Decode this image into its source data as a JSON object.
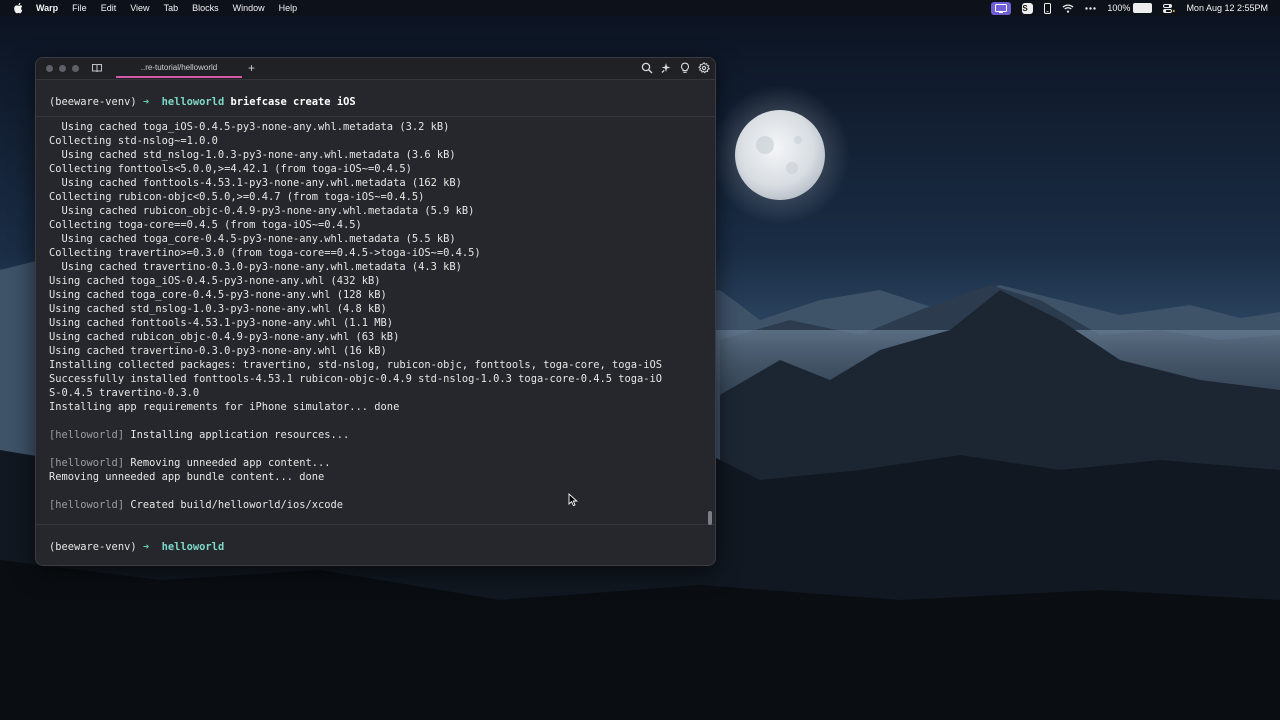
{
  "menubar": {
    "app_name": "Warp",
    "menus": [
      "File",
      "Edit",
      "View",
      "Tab",
      "Blocks",
      "Window",
      "Help"
    ],
    "battery_percent": "100%",
    "datetime": "Mon Aug 12  2:55PM",
    "s_badge": "S"
  },
  "window": {
    "tab_title": "..re-tutorial/helloworld",
    "new_tab_symbol": "+"
  },
  "terminal": {
    "first_prompt": {
      "venv": "(beeware-venv)",
      "arrow": "➜",
      "cwd": "helloworld",
      "command": "briefcase create iOS"
    },
    "output": [
      {
        "text": "  Using cached toga_iOS-0.4.5-py3-none-any.whl.metadata (3.2 kB)"
      },
      {
        "text": "Collecting std-nslog~=1.0.0"
      },
      {
        "text": "  Using cached std_nslog-1.0.3-py3-none-any.whl.metadata (3.6 kB)"
      },
      {
        "text": "Collecting fonttools<5.0.0,>=4.42.1 (from toga-iOS~=0.4.5)"
      },
      {
        "text": "  Using cached fonttools-4.53.1-py3-none-any.whl.metadata (162 kB)"
      },
      {
        "text": "Collecting rubicon-objc<0.5.0,>=0.4.7 (from toga-iOS~=0.4.5)"
      },
      {
        "text": "  Using cached rubicon_objc-0.4.9-py3-none-any.whl.metadata (5.9 kB)"
      },
      {
        "text": "Collecting toga-core==0.4.5 (from toga-iOS~=0.4.5)"
      },
      {
        "text": "  Using cached toga_core-0.4.5-py3-none-any.whl.metadata (5.5 kB)"
      },
      {
        "text": "Collecting travertino>=0.3.0 (from toga-core==0.4.5->toga-iOS~=0.4.5)"
      },
      {
        "text": "  Using cached travertino-0.3.0-py3-none-any.whl.metadata (4.3 kB)"
      },
      {
        "text": "Using cached toga_iOS-0.4.5-py3-none-any.whl (432 kB)"
      },
      {
        "text": "Using cached toga_core-0.4.5-py3-none-any.whl (128 kB)"
      },
      {
        "text": "Using cached std_nslog-1.0.3-py3-none-any.whl (4.8 kB)"
      },
      {
        "text": "Using cached fonttools-4.53.1-py3-none-any.whl (1.1 MB)"
      },
      {
        "text": "Using cached rubicon_objc-0.4.9-py3-none-any.whl (63 kB)"
      },
      {
        "text": "Using cached travertino-0.3.0-py3-none-any.whl (16 kB)"
      },
      {
        "text": "Installing collected packages: travertino, std-nslog, rubicon-objc, fonttools, toga-core, toga-iOS"
      },
      {
        "text": "Successfully installed fonttools-4.53.1 rubicon-objc-0.4.9 std-nslog-1.0.3 toga-core-0.4.5 toga-iO"
      },
      {
        "text": "S-0.4.5 travertino-0.3.0"
      },
      {
        "text": "Installing app requirements for iPhone simulator... done"
      },
      {
        "text": ""
      },
      {
        "tag": "[helloworld]",
        "text": " Installing application resources..."
      },
      {
        "text": ""
      },
      {
        "tag": "[helloworld]",
        "text": " Removing unneeded app content..."
      },
      {
        "text": "Removing unneeded app bundle content... done"
      },
      {
        "text": ""
      },
      {
        "tag": "[helloworld]",
        "text": " Created build/helloworld/ios/xcode"
      }
    ],
    "active_prompt": {
      "venv": "(beeware-venv)",
      "arrow": "➜",
      "cwd": "helloworld"
    }
  }
}
